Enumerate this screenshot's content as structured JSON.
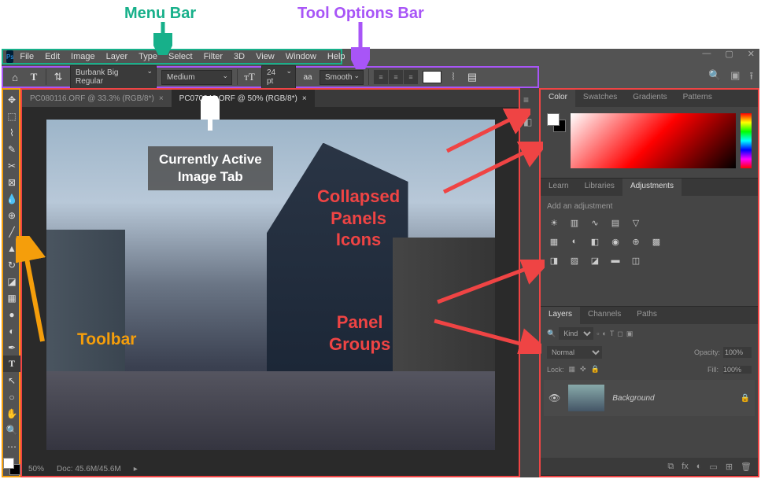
{
  "annotations": {
    "menu_bar": "Menu Bar",
    "options_bar": "Tool Options Bar",
    "active_tab_l1": "Currently Active",
    "active_tab_l2": "Image Tab",
    "collapsed_l1": "Collapsed",
    "collapsed_l2": "Panels",
    "collapsed_l3": "Icons",
    "panel_l1": "Panel",
    "panel_l2": "Groups",
    "toolbar": "Toolbar"
  },
  "menubar": {
    "logo": "Ps",
    "items": [
      "File",
      "Edit",
      "Image",
      "Layer",
      "Type",
      "Select",
      "Filter",
      "3D",
      "View",
      "Window",
      "Help"
    ]
  },
  "optionsbar": {
    "font": "Burbank Big Regular",
    "weight": "Medium",
    "size": "24 pt",
    "aa_label": "aa",
    "aa": "Smooth"
  },
  "tabs": [
    {
      "label": "PC080116.ORF @ 33.3% (RGB/8*)",
      "active": false
    },
    {
      "label": "PC070046.ORF @ 50% (RGB/8*)",
      "active": true
    }
  ],
  "statusbar": {
    "zoom": "50%",
    "doc": "Doc: 45.6M/45.6M"
  },
  "panels": {
    "color_tabs": [
      "Color",
      "Swatches",
      "Gradients",
      "Patterns"
    ],
    "adj_tabs": [
      "Learn",
      "Libraries",
      "Adjustments"
    ],
    "adj_label": "Add an adjustment",
    "layer_tabs": [
      "Layers",
      "Channels",
      "Paths"
    ],
    "layer_kind": "Kind",
    "blend": "Normal",
    "opacity_label": "Opacity:",
    "opacity": "100%",
    "lock_label": "Lock:",
    "fill_label": "Fill:",
    "fill": "100%",
    "bg_layer": "Background"
  },
  "search_placeholder": "Kind"
}
